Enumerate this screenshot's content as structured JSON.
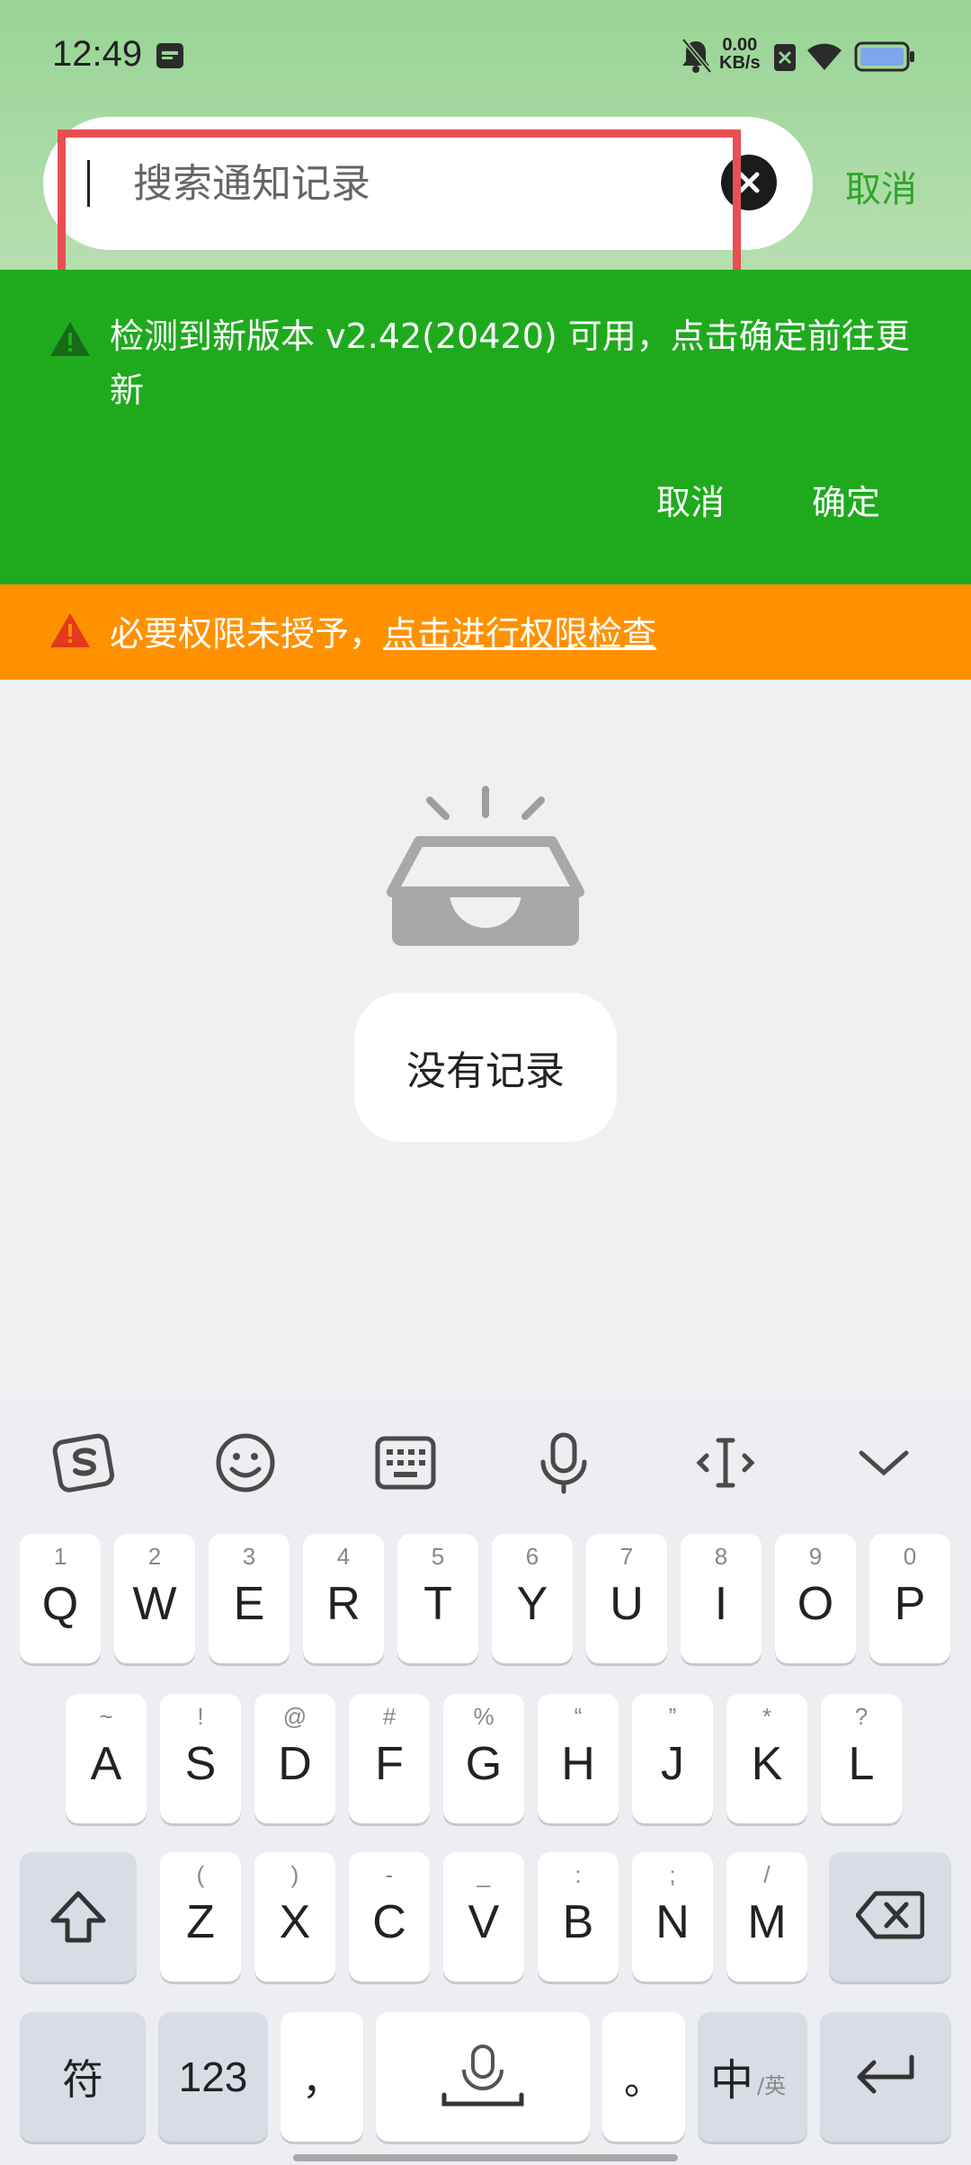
{
  "status_bar": {
    "time": "12:49",
    "net_speed_value": "0.00",
    "net_speed_unit": "KB/s"
  },
  "search": {
    "placeholder": "搜索通知记录",
    "value": "",
    "cancel_label": "取消"
  },
  "update_banner": {
    "message": "检测到新版本 v2.42(20420) 可用，点击确定前往更新",
    "cancel_label": "取消",
    "confirm_label": "确定"
  },
  "permission_banner": {
    "message_prefix": "必要权限未授予，",
    "link_text": "点击进行权限检查"
  },
  "empty_state": {
    "text": "没有记录"
  },
  "keyboard": {
    "row1": [
      {
        "main": "Q",
        "sub": "1"
      },
      {
        "main": "W",
        "sub": "2"
      },
      {
        "main": "E",
        "sub": "3"
      },
      {
        "main": "R",
        "sub": "4"
      },
      {
        "main": "T",
        "sub": "5"
      },
      {
        "main": "Y",
        "sub": "6"
      },
      {
        "main": "U",
        "sub": "7"
      },
      {
        "main": "I",
        "sub": "8"
      },
      {
        "main": "O",
        "sub": "9"
      },
      {
        "main": "P",
        "sub": "0"
      }
    ],
    "row2": [
      {
        "main": "A",
        "sub": "~"
      },
      {
        "main": "S",
        "sub": "!"
      },
      {
        "main": "D",
        "sub": "@"
      },
      {
        "main": "F",
        "sub": "#"
      },
      {
        "main": "G",
        "sub": "%"
      },
      {
        "main": "H",
        "sub": "“"
      },
      {
        "main": "J",
        "sub": "”"
      },
      {
        "main": "K",
        "sub": "*"
      },
      {
        "main": "L",
        "sub": "?"
      }
    ],
    "row3": [
      {
        "main": "Z",
        "sub": "("
      },
      {
        "main": "X",
        "sub": ")"
      },
      {
        "main": "C",
        "sub": "-"
      },
      {
        "main": "V",
        "sub": "_"
      },
      {
        "main": "B",
        "sub": ":"
      },
      {
        "main": "N",
        "sub": ";"
      },
      {
        "main": "M",
        "sub": "/"
      }
    ],
    "symbols_label": "符",
    "numbers_label": "123",
    "comma_label": "，",
    "period_label": "。",
    "lang_main": "中",
    "lang_sub": "/英"
  }
}
